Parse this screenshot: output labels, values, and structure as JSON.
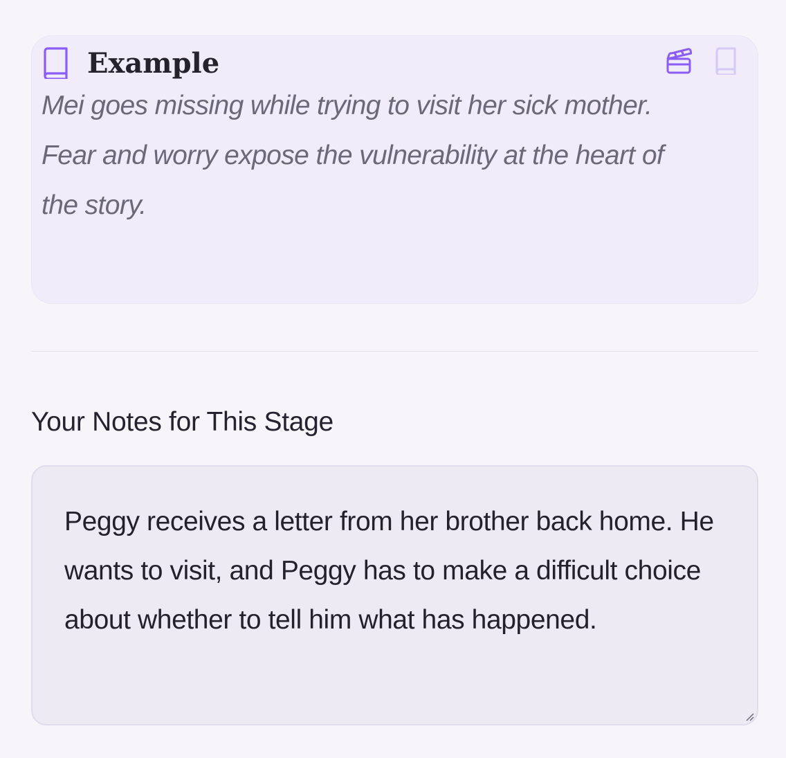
{
  "example_card": {
    "icon": "book-icon",
    "title": "Example",
    "text": "Mei goes missing while trying to visit her sick mother. Fear and worry expose the vulnerability at the heart of the story.",
    "actions": [
      {
        "icon": "clapperboard-icon",
        "state": "active"
      },
      {
        "icon": "book-icon",
        "state": "inactive"
      }
    ],
    "accent_color": "#8b5cf6",
    "inactive_icon_color": "#d6c9f5"
  },
  "notes": {
    "label": "Your Notes for This Stage",
    "value": "Peggy receives a letter from her brother back home. He wants to visit, and Peggy has to make a difficult choice about whether to tell him what has happened."
  }
}
